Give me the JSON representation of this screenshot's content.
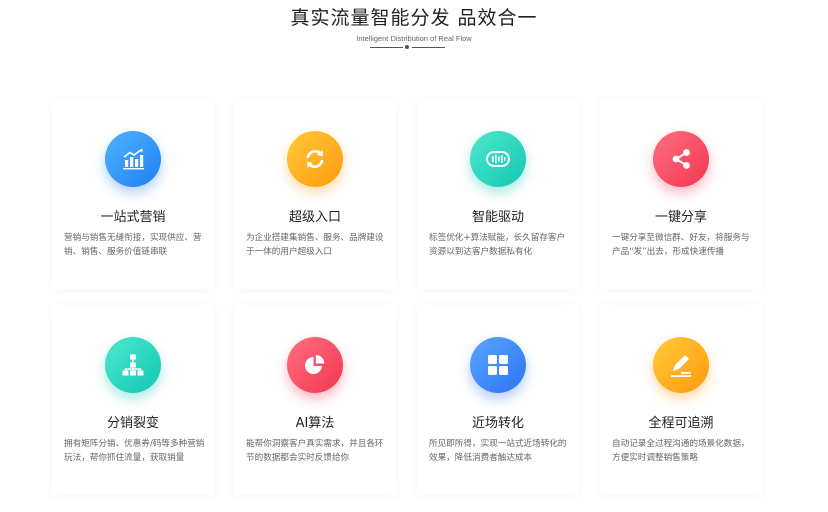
{
  "header": {
    "title": "真实流量智能分发 品效合一",
    "subtitle": "Intelligent Distribution of Real Flow"
  },
  "colors": {
    "blue": "#1e7ff2",
    "orange": "#ff9a0d",
    "teal": "#13c7b2",
    "red": "#f2364f"
  },
  "cards": [
    {
      "icon": "bar-chart-icon",
      "title": "一站式营销",
      "desc": "营销与销售无缝衔接，实现供应、营销、销售、服务价值链串联"
    },
    {
      "icon": "refresh-icon",
      "title": "超级入口",
      "desc": "为企业搭建集销售、服务、品牌建设于一体的用户超级入口"
    },
    {
      "icon": "sound-wave-icon",
      "title": "智能驱动",
      "desc": "标签优化+算法赋能，长久留存客户资源以到达客户数据私有化"
    },
    {
      "icon": "share-icon",
      "title": "一键分享",
      "desc": "一键分享至微信群、好友，将服务与产品“发”出去，形成快速传播"
    },
    {
      "icon": "org-chart-icon",
      "title": "分销裂变",
      "desc": "拥有矩阵分销、优惠券/码等多种营销玩法，帮你抓住流量，获取销量"
    },
    {
      "icon": "pie-chart-icon",
      "title": "AI算法",
      "desc": "能帮你洞察客户真实需求，并且各环节的数据都会实时反馈给你"
    },
    {
      "icon": "grid-icon",
      "title": "近场转化",
      "desc": "所见即所得，实现一站式近场转化的效果，降低消费者触达成本"
    },
    {
      "icon": "edit-icon",
      "title": "全程可追溯",
      "desc": "自动记录全过程沟通的场景化数据，方便实时调整销售策略"
    }
  ]
}
